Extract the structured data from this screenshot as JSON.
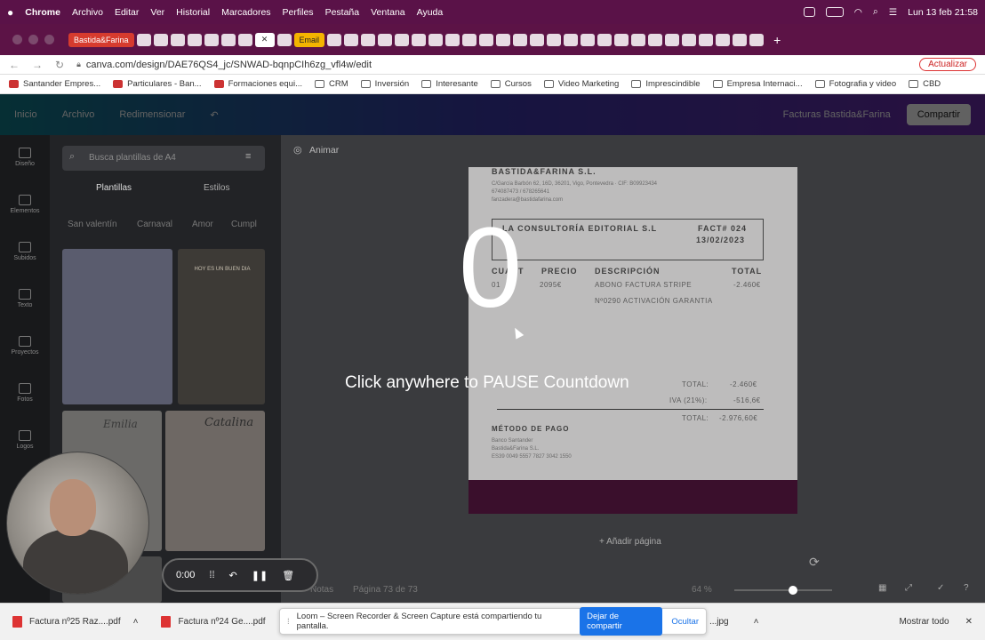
{
  "menubar": {
    "app": "Chrome",
    "items": [
      "Archivo",
      "Editar",
      "Ver",
      "Historial",
      "Marcadores",
      "Perfiles",
      "Pestaña",
      "Ventana",
      "Ayuda"
    ],
    "clock": "Lun 13 feb 21:58"
  },
  "tabs": {
    "first_named": "Bastida&Farina",
    "email": "Email"
  },
  "address": {
    "url": "canva.com/design/DAE76QS4_jc/SNWAD-bqnpCIh6zg_vfl4w/edit",
    "update_label": "Actualizar"
  },
  "bookmarks": [
    "Santander Empres...",
    "Particulares - Ban...",
    "Formaciones equi...",
    "CRM",
    "Inversión",
    "Interesante",
    "Cursos",
    "Video Marketing",
    "Imprescindible",
    "Empresa Internaci...",
    "Fotografia y video",
    "CBD"
  ],
  "canva_top": {
    "inicio": "Inicio",
    "archivo": "Archivo",
    "redimensionar": "Redimensionar",
    "doc_title": "Facturas Bastida&Farina",
    "share": "Compartir"
  },
  "rail": [
    "Diseño",
    "Elementos",
    "Subidos",
    "Texto",
    "Proyectos",
    "Fotos",
    "Logos"
  ],
  "panel": {
    "search_placeholder": "Busca plantillas de A4",
    "tab_templates": "Plantillas",
    "tab_styles": "Estilos",
    "chips": [
      "San valentín",
      "Carnaval",
      "Amor",
      "Cumpl"
    ],
    "thumb_text_1": "HOY ES UN BUEN DIA",
    "thumb_text_2": "Emilia",
    "thumb_text_3": "Catalina"
  },
  "canvas": {
    "animate": "Animar",
    "add_page": "+ Añadir página",
    "notes": "Notas",
    "page_info": "Página 73 de 73",
    "zoom": "64 %"
  },
  "invoice": {
    "company": "BASTIDA&FARINA S.L.",
    "address": "C/García Barbón 62, 16D, 36201, Vigo, Pontevedra · CIF: B09923434",
    "phones": "674087473 / 678265641",
    "email": "fanzadera@bastidafarina.com",
    "client": "LA CONSULTORÍA EDITORIAL S.L",
    "fact": "FACT# 024",
    "date": "13/02/2023",
    "col_qty": "CUANT",
    "col_price": "PRECIO",
    "col_desc": "DESCRIPCIÓN",
    "col_total": "TOTAL",
    "qty": "01",
    "price": "2095€",
    "desc1": "ABONO FACTURA STRIPE",
    "desc2": "Nº0290 ACTIVACIÓN GARANTIA",
    "line_total": "-2.460€",
    "total_label": "TOTAL:",
    "total_value": "-2.460€",
    "iva_label": "IVA (21%):",
    "iva_value": "-516,6€",
    "grand_label": "TOTAL:",
    "grand_value": "-2.976,60€",
    "pay_title": "MÉTODO DE PAGO",
    "bank": "Banco Santander",
    "holder": "Bastida&Farina S.L.",
    "iban": "ES39 0049 5557 7827 3042 1550"
  },
  "overlay": {
    "countdown": "0",
    "hint": "Click anywhere to PAUSE Countdown"
  },
  "loom": {
    "time": "0:00"
  },
  "downloads": {
    "file1": "Factura nº25 Raz....pdf",
    "file2": "Factura nº24 Ge....pdf",
    "file3": "...jpg",
    "show_all": "Mostrar todo"
  },
  "share_bar": {
    "message": "Loom – Screen Recorder & Screen Capture está compartiendo tu pantalla.",
    "stop": "Dejar de compartir",
    "hide": "Ocultar"
  },
  "colors": {
    "menubar": "#5a1248",
    "accent_blue": "#1a73e8",
    "invoice_band": "#3a0f2c"
  }
}
